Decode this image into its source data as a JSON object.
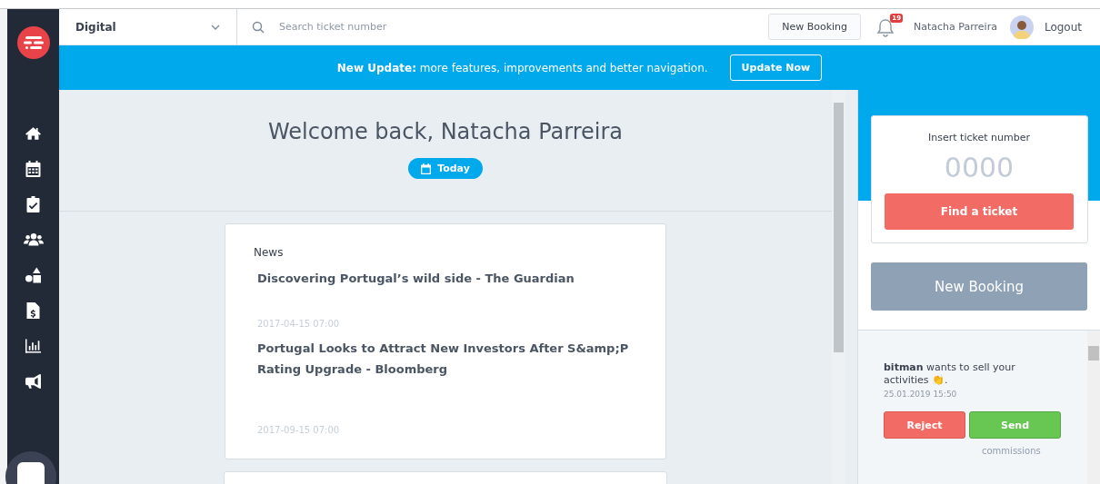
{
  "topbar": {
    "dropdown": {
      "value": "Digital"
    },
    "search": {
      "placeholder": "Search ticket number"
    },
    "new_booking": "New Booking",
    "notifications": {
      "count": "19"
    },
    "user": "Natacha Parreira",
    "logout": "Logout"
  },
  "banner": {
    "text": "**New Update:** more features, improvements and better navigation.",
    "button": "Update Now"
  },
  "sidebar": {
    "items": [
      {
        "kind": "home"
      },
      {
        "kind": "calendar"
      },
      {
        "kind": "clipboard"
      },
      {
        "kind": "users"
      },
      {
        "kind": "shapes"
      },
      {
        "kind": "invoice"
      },
      {
        "kind": "chart"
      },
      {
        "kind": "megaphone"
      }
    ]
  },
  "welcome": {
    "title": "Welcome back, Natacha Parreira",
    "date_button": "Today"
  },
  "news": {
    "heading": "News",
    "items": [
      {
        "title": "Discovering Portugal’s wild side - The Guardian",
        "date": "2017-04-15 07:00"
      },
      {
        "title": "Portugal Looks to Attract New Investors After S&amp;P Rating Upgrade - Bloomberg",
        "date": "2017-09-15 07:00"
      }
    ]
  },
  "ticket": {
    "label": "Insert ticket number",
    "placeholder": "0000",
    "button": "Find a ticket"
  },
  "new_booking": "New Booking",
  "notification": {
    "text": "**bitman** wants to sell your activities 👏.",
    "time": "25.01.2019 15:50",
    "reject": "Reject",
    "send": "Send",
    "tooltip": "commissions"
  }
}
